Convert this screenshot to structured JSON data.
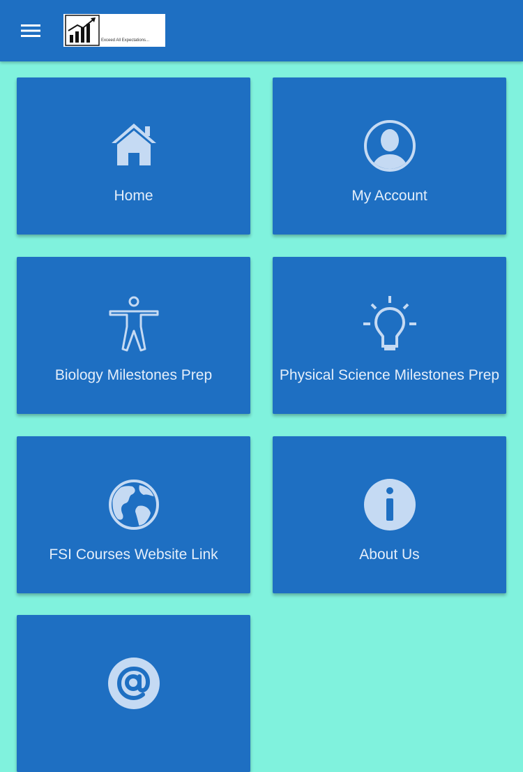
{
  "app": {
    "logo_tagline": "Exceed All Expectations..."
  },
  "colors": {
    "appbar": "#1E6FC2",
    "background": "#80F2DD",
    "tile": "#1E6FC2",
    "icon_fill": "#C5DAF3",
    "label_text": "#E4EEFA"
  },
  "header": {
    "menu_icon": "hamburger-menu-icon",
    "logo_icon": "bar-chart-up-arrow-icon"
  },
  "tiles": [
    {
      "label": "Home",
      "icon": "house-icon"
    },
    {
      "label": "My Account",
      "icon": "user-circle-icon"
    },
    {
      "label": "Biology Milestones Prep",
      "icon": "human-figure-icon"
    },
    {
      "label": "Physical Science Milestones Prep",
      "icon": "lightbulb-icon"
    },
    {
      "label": "FSI Courses Website Link",
      "icon": "globe-icon"
    },
    {
      "label": "About Us",
      "icon": "info-circle-icon"
    },
    {
      "label": "",
      "icon": "at-sign-icon"
    }
  ]
}
